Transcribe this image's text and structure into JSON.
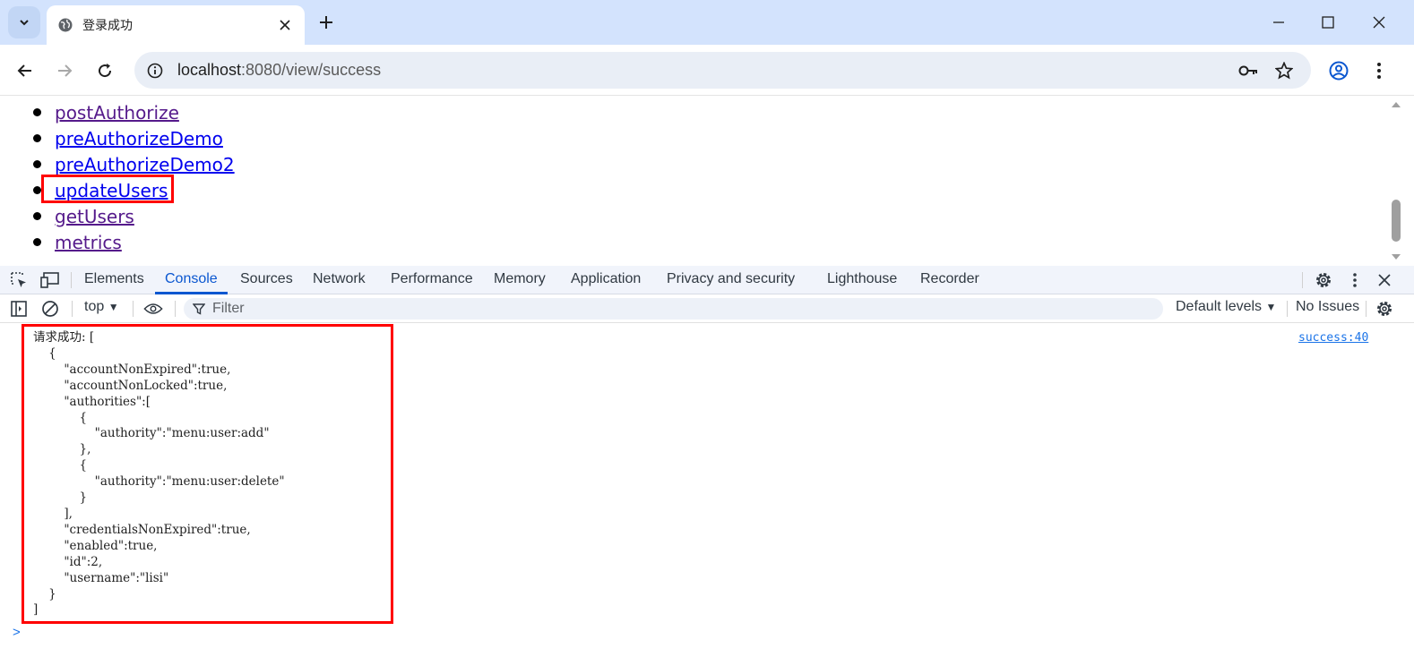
{
  "tab": {
    "title": "登录成功"
  },
  "omnibox": {
    "url_host": "localhost",
    "url_rest": ":8080/view/success"
  },
  "page": {
    "links": [
      {
        "label": "postAuthorize",
        "visited": true
      },
      {
        "label": "preAuthorizeDemo",
        "visited": false
      },
      {
        "label": "preAuthorizeDemo2",
        "visited": false
      },
      {
        "label": "updateUsers",
        "visited": false
      },
      {
        "label": "getUsers",
        "visited": true
      },
      {
        "label": "metrics",
        "visited": true
      }
    ]
  },
  "devtools": {
    "tabs": [
      "Elements",
      "Console",
      "Sources",
      "Network",
      "Performance",
      "Memory",
      "Application",
      "Privacy and security",
      "Lighthouse",
      "Recorder"
    ],
    "active_tab": "Console",
    "context": "top",
    "filter_placeholder": "Filter",
    "levels": "Default levels",
    "issues": "No Issues"
  },
  "console": {
    "message": "请求成功: [\n    {\n        \"accountNonExpired\":true,\n        \"accountNonLocked\":true,\n        \"authorities\":[\n            {\n                \"authority\":\"menu:user:add\"\n            },\n            {\n                \"authority\":\"menu:user:delete\"\n            }\n        ],\n        \"credentialsNonExpired\":true,\n        \"enabled\":true,\n        \"id\":2,\n        \"username\":\"lisi\"\n    }\n]",
    "source": "success:40",
    "prompt": ">"
  },
  "colors": {
    "highlight": "#ff0000",
    "accent": "#0b57d0",
    "tabstrip": "#d3e3fd"
  }
}
